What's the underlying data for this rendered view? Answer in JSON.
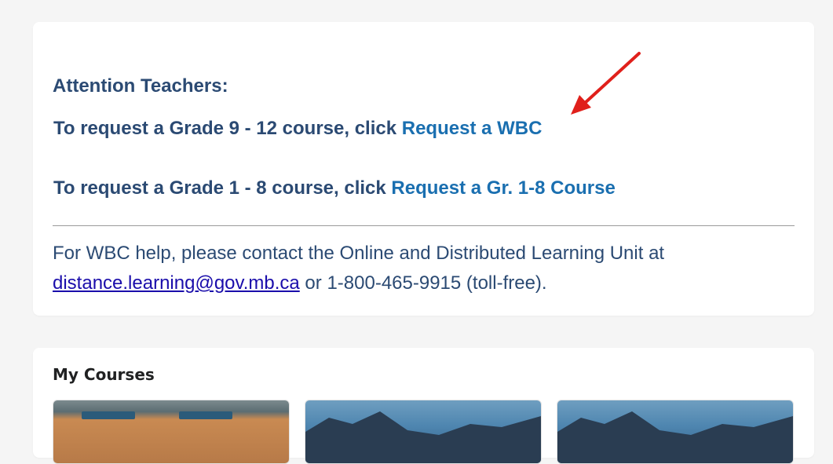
{
  "announcement": {
    "heading": "Attention Teachers:",
    "request_high": {
      "prefix": "To request a Grade 9 - 12 course, click ",
      "link": "Request a WBC"
    },
    "request_elem": {
      "prefix": "To request a Grade 1 - 8 course, click ",
      "link": "Request a Gr. 1-8 Course"
    },
    "help": {
      "prefix": "For WBC help, please contact the Online and Distributed Learning Unit at",
      "email": "distance.learning@gov.mb.ca",
      "suffix": " or 1-800-465-9915 (toll-free)."
    }
  },
  "my_courses": {
    "title": "My Courses",
    "tiles": [
      {
        "image": "classroom"
      },
      {
        "image": "mountains"
      },
      {
        "image": "mountains"
      }
    ]
  },
  "colors": {
    "text_dark_blue": "#2b4a73",
    "link_blue": "#1a6fb0",
    "annotation_arrow": "#e0201b"
  }
}
